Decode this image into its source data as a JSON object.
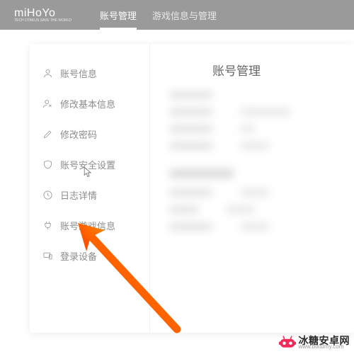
{
  "header": {
    "logo": "miHoYo",
    "logo_sub": "TECH OTAKUS SAVE THE WORLD",
    "nav": {
      "account": "账号管理",
      "gameinfo": "游戏信息与管理"
    }
  },
  "sidebar": {
    "items": [
      {
        "label": "账号信息",
        "icon": "user"
      },
      {
        "label": "修改基本信息",
        "icon": "user-edit"
      },
      {
        "label": "修改密码",
        "icon": "pencil"
      },
      {
        "label": "账号安全设置",
        "icon": "shield"
      },
      {
        "label": "日志详情",
        "icon": "clock"
      },
      {
        "label": "账号游戏信息",
        "icon": "plug"
      },
      {
        "label": "登录设备",
        "icon": "device"
      }
    ]
  },
  "content": {
    "title": "账号管理"
  },
  "watermark": {
    "text": "冰糖安卓网",
    "url": "www.btxtdmy.com"
  }
}
